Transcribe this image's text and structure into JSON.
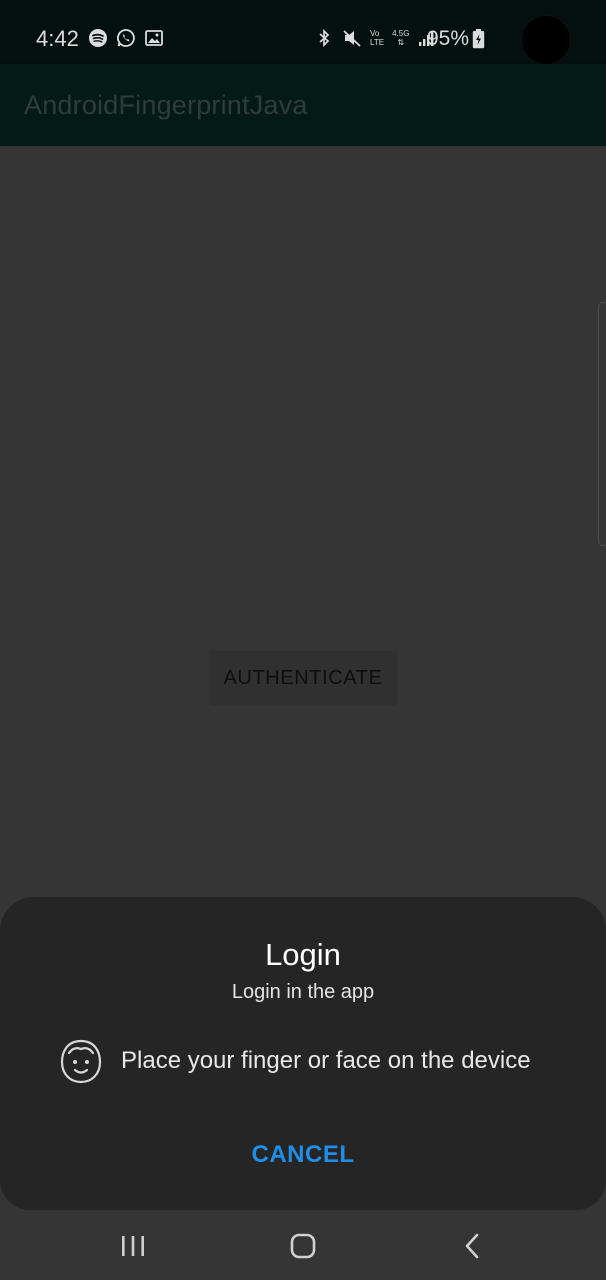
{
  "status_bar": {
    "time": "4:42",
    "battery_percent": "95%",
    "left_icons": [
      "spotify-icon",
      "whatsapp-icon",
      "gallery-icon"
    ],
    "right_icons": [
      "bluetooth-icon",
      "mute-icon",
      "volte-icon",
      "network-4-5g-icon",
      "signal-icon",
      "battery-charging-icon"
    ],
    "network_label_top": "4.5G",
    "volte_label_top": "Vo",
    "volte_label_bottom": "LTE"
  },
  "app_bar": {
    "title": "AndroidFingerprintJava"
  },
  "main": {
    "authenticate_label": "AUTHENTICATE"
  },
  "biometric_sheet": {
    "title": "Login",
    "subtitle": "Login in the app",
    "message": "Place your finger or face on the device",
    "cancel_label": "CANCEL",
    "icon": "face-icon"
  },
  "nav_bar": {
    "items": [
      "recents-icon",
      "home-icon",
      "back-icon"
    ]
  },
  "colors": {
    "status_bg": "#04100f",
    "app_bar_bg": "#031a17",
    "scrim_bg": "#353535",
    "sheet_bg": "#252525",
    "accent": "#1e8ee8"
  }
}
